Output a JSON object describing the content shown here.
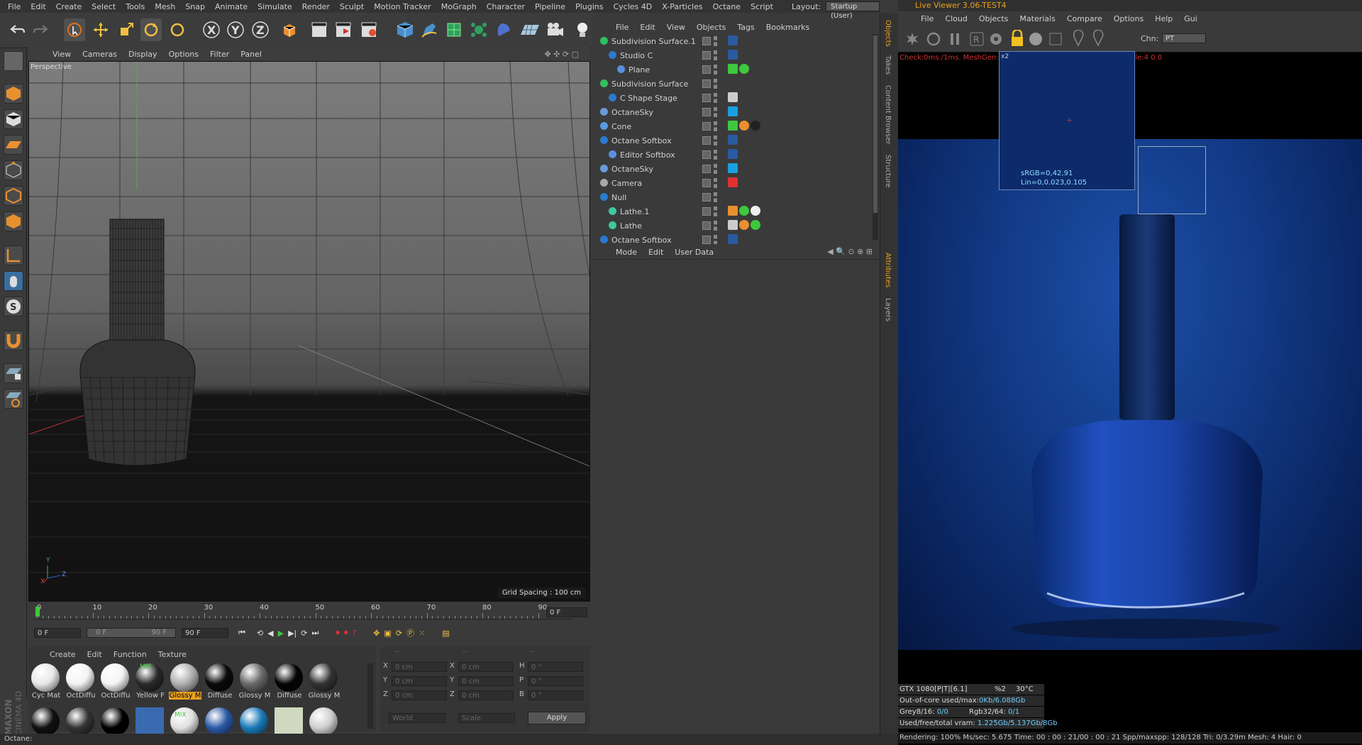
{
  "menubar": {
    "items": [
      "File",
      "Edit",
      "Create",
      "Select",
      "Tools",
      "Mesh",
      "Snap",
      "Animate",
      "Simulate",
      "Render",
      "Sculpt",
      "Motion Tracker",
      "MoGraph",
      "Character",
      "Pipeline",
      "Plugins",
      "Cycles 4D",
      "X-Particles",
      "Octane",
      "Script"
    ],
    "layout_label": "Layout:",
    "layout_value": "Startup (User)"
  },
  "viewport": {
    "menu": [
      "View",
      "Cameras",
      "Display",
      "Options",
      "Filter",
      "Panel"
    ],
    "label": "Perspective",
    "grid_spacing": "Grid Spacing : 100 cm",
    "axis_y": "Y",
    "axis_z": "Z",
    "axis_x": "X"
  },
  "timeline": {
    "ticks": [
      "0",
      "10",
      "20",
      "30",
      "40",
      "50",
      "60",
      "70",
      "80",
      "90"
    ],
    "frame_end": "0 F",
    "field1": "0 F",
    "field2_left": "0 F",
    "field2_right": "90 F",
    "field3": "90 F"
  },
  "materials": {
    "menu": [
      "Create",
      "Edit",
      "Function",
      "Texture"
    ],
    "row1": [
      {
        "label": "Cyc Mat",
        "color": "#e8e8e8"
      },
      {
        "label": "OctDiffu",
        "color": "#f4f4f4"
      },
      {
        "label": "OctDiffu",
        "color": "#f4f4f4"
      },
      {
        "label": "Yellow F",
        "color": "#2a2a2a"
      },
      {
        "label": "Glossy M",
        "color": "#b0b0b0"
      },
      {
        "label": "Diffuse",
        "color": "#0a0a0a"
      },
      {
        "label": "Glossy M",
        "color": "#6a6a6a"
      },
      {
        "label": "Diffuse",
        "color": "#050505"
      },
      {
        "label": "Glossy M",
        "color": "#333"
      }
    ],
    "row2_colors": [
      "#111",
      "#333",
      "#000",
      "#3a6ab0",
      "#e0e0e0",
      "#2c5aa8",
      "#1a7ab8",
      "#d0d8c0",
      "#cfcfcf"
    ],
    "mix_label": "MIX"
  },
  "coords": {
    "header": [
      "--",
      "--",
      "--"
    ],
    "rows": [
      {
        "a": "X",
        "av": "0 cm",
        "b": "X",
        "bv": "0 cm",
        "c": "H",
        "cv": "0 °"
      },
      {
        "a": "Y",
        "av": "0 cm",
        "b": "Y",
        "bv": "0 cm",
        "c": "P",
        "cv": "0 °"
      },
      {
        "a": "Z",
        "av": "0 cm",
        "b": "Z",
        "bv": "0 cm",
        "c": "B",
        "cv": "0 °"
      }
    ],
    "world": "World",
    "scale": "Scale",
    "apply": "Apply"
  },
  "object_manager": {
    "menu": [
      "File",
      "Edit",
      "View",
      "Objects",
      "Tags",
      "Bookmarks"
    ],
    "objects": [
      {
        "name": "Subdivision Surface.1",
        "indent": 0
      },
      {
        "name": "Studio C",
        "indent": 1
      },
      {
        "name": "Plane",
        "indent": 2
      },
      {
        "name": "Subdivision Surface",
        "indent": 0
      },
      {
        "name": "C Shape Stage",
        "indent": 1
      },
      {
        "name": "OctaneSky",
        "indent": 0
      },
      {
        "name": "Cone",
        "indent": 0
      },
      {
        "name": "Octane Softbox",
        "indent": 0
      },
      {
        "name": "Editor Softbox",
        "indent": 1
      },
      {
        "name": "OctaneSky",
        "indent": 0
      },
      {
        "name": "Camera",
        "indent": 0
      },
      {
        "name": "Null",
        "indent": 0
      },
      {
        "name": "Lathe.1",
        "indent": 1
      },
      {
        "name": "Lathe",
        "indent": 1
      },
      {
        "name": "Octane Softbox",
        "indent": 0
      }
    ]
  },
  "attribute_manager": {
    "menu": [
      "Mode",
      "Edit",
      "User Data"
    ]
  },
  "side_tabs": {
    "top": [
      "Objects",
      "Takes",
      "Content Browser",
      "Structure"
    ],
    "bottom": [
      "Attributes",
      "Layers"
    ]
  },
  "live_viewer": {
    "title": "Live Viewer 3.06-TEST4",
    "menu": [
      "File",
      "Cloud",
      "Objects",
      "Materials",
      "Compare",
      "Options",
      "Help",
      "Gui"
    ],
    "chn_label": "Chn:",
    "chn_value": "PT",
    "check_text": "Check:0ms./1ms. MeshGen:0ms. Update[E]:0ms. Nodes:40 Movable:4  0 0",
    "zoom_label": "x2",
    "srgb": "sRGB=0,42,91",
    "lin": "Lin=0,0.023,0.105",
    "stats": [
      {
        "a": "GTX 1080[P|T|[6.1]",
        "b": "%2",
        "c": "30°C"
      },
      {
        "a": "Out-of-core used/max:",
        "v": "0Kb/6.088Gb"
      },
      {
        "a": "Grey8/16: ",
        "v": "0/0",
        "b": "Rgb32/64: ",
        "bv": "0/1"
      },
      {
        "a": "Used/free/total vram: ",
        "v": "1.225Gb/5.137Gb/8Gb"
      }
    ],
    "render_line": "Rendering: 100%  Ms/sec: 5.675  Time: 00 : 00 : 21/00 : 00 : 21  Spp/maxspp: 128/128  Tri: 0/3.29m   Mesh: 4  Hair: 0"
  },
  "status_bar": "Octane:",
  "maxon_logo": "MAXON CINEMA 4D",
  "colors": {
    "accent": "#e8a020",
    "viewport_bg_top": "#7d7d7d",
    "render_blue": "#0c2f6e"
  }
}
